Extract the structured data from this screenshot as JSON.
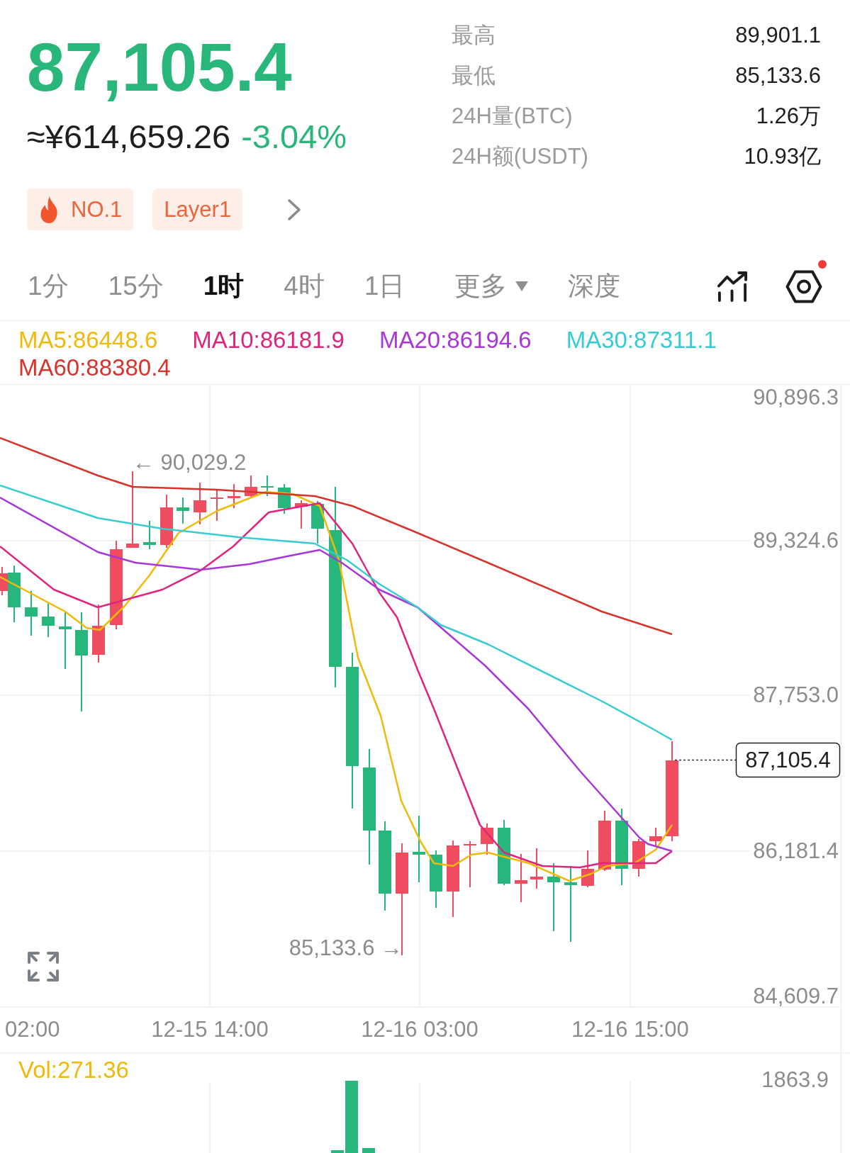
{
  "price": {
    "last": "87,105.4",
    "fiat": "≈¥614,659.26",
    "change": "-3.04%",
    "falling": true
  },
  "tags": [
    {
      "kind": "rank",
      "label": "NO.1"
    },
    {
      "kind": "sector",
      "label": "Layer1"
    }
  ],
  "stats": [
    {
      "label": "最高",
      "value": "89,901.1"
    },
    {
      "label": "最低",
      "value": "85,133.6"
    },
    {
      "label": "24H量(BTC)",
      "value": "1.26万"
    },
    {
      "label": "24H额(USDT)",
      "value": "10.93亿"
    }
  ],
  "tabs": [
    {
      "label": "1分",
      "kind": "tab",
      "selected": false
    },
    {
      "label": "15分",
      "kind": "tab",
      "selected": false
    },
    {
      "label": "1时",
      "kind": "tab",
      "selected": true
    },
    {
      "label": "4时",
      "kind": "tab",
      "selected": false
    },
    {
      "label": "1日",
      "kind": "tab",
      "selected": false
    },
    {
      "label": "更多",
      "kind": "dropdown",
      "selected": false
    },
    {
      "label": "深度",
      "kind": "tab",
      "selected": false
    }
  ],
  "toolbar": {
    "settings_badge": true
  },
  "ma_legend": [
    {
      "label": "MA5:86448.6",
      "color": "#f0b90b"
    },
    {
      "label": "MA10:86181.9",
      "color": "#e0237d"
    },
    {
      "label": "MA20:86194.6",
      "color": "#a737d8"
    },
    {
      "label": "MA30:87311.1",
      "color": "#36ccd2"
    },
    {
      "label": "MA60:88380.4",
      "color": "#d8332a"
    }
  ],
  "chart": {
    "price_labels": [
      "90,896.3",
      "89,324.6",
      "87,753.0",
      "86,181.4",
      "84,609.7"
    ],
    "time_labels": [
      "02:00",
      "12-15 14:00",
      "12-16 03:00",
      "12-16 15:00"
    ],
    "high_marker": "← 90,029.2",
    "low_marker": "85,133.6 →",
    "last_price_tag": "87,105.4"
  },
  "volume": {
    "label": "Vol:271.36",
    "max_label": "1863.9"
  }
}
